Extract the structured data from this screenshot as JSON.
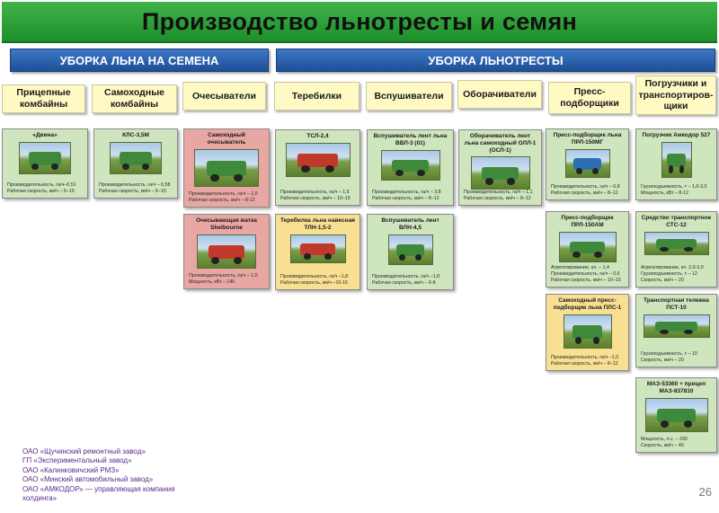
{
  "title": "Производство льнотресты и семян",
  "sections": {
    "seeds": "УБОРКА ЛЬНА НА СЕМЕНА",
    "straw": "УБОРКА ЛЬНОТРЕСТЫ"
  },
  "categories": [
    "Прицепные комбайны",
    "Самоходные комбайны",
    "Очесыватели",
    "Теребилки",
    "Вспушиватели",
    "Оборачиватели",
    "Пресс-подборщики",
    "Погрузчики и транспортиров-щики"
  ],
  "cards": {
    "dvina": {
      "title": "«Двина»",
      "lines": [
        "Производительность, га/ч–0,51",
        "Рабочая скорость, км/ч – 6–10"
      ]
    },
    "kls": {
      "title": "КЛС-3,5М",
      "lines": [
        "Производительность, га/ч – 0,58",
        "Рабочая скорость, км/ч – 6–10"
      ]
    },
    "ocheс_self": {
      "title": "Самоходный очесыватель",
      "lines": [
        "Производительность, га/ч – 1,0",
        "Рабочая скорость, км/ч – 8-12"
      ]
    },
    "shelbourne": {
      "title": "Очесывающая жатка Shelbourne",
      "lines": [
        "Производительность, га/ч – 1,0",
        "Мощность, кВт – 140"
      ]
    },
    "tsl": {
      "title": "ТСЛ-2,4",
      "lines": [
        "Производительность, га/ч – 1,5",
        "Рабочая скорость, км/ч – 10–15"
      ]
    },
    "tln": {
      "title": "Теребилка льна навесная ТЛН-1,5-2",
      "lines": [
        "Производительность, га/ч –1,8",
        "Рабочая скорость, км/ч –10-15"
      ]
    },
    "vvl3": {
      "title": "Вспушиватель лент льна ВВЛ-3 (01)",
      "lines": [
        "Производительность, га/ч – 3,8",
        "Рабочая скорость, км/ч – 8–12"
      ]
    },
    "vln": {
      "title": "Вспушиватель лент ВЛН-4,5",
      "lines": [
        "Производительность, га/ч –1,8",
        "Рабочая скорость, км/ч – 6-8"
      ]
    },
    "oll": {
      "title": "Оборачиватель лент льна самоходный ОЛЛ-1 (ОСЛ-1)",
      "lines": [
        "Производительность, га/ч – 1,1",
        "Рабочая скорость, км/ч – 8–12"
      ]
    },
    "prl150mg": {
      "title": "Пресс-подборщик льна ПРЛ-150МГ",
      "lines": [
        "Производительность, га/ч – 0,8",
        "Рабочая скорость, км/ч – 8–12"
      ]
    },
    "prl150am": {
      "title": "Пресс-подборщик ПРЛ-150АМ",
      "lines": [
        "Агрегатирование, кл. – 1,4",
        "Производительность, га/ч – 0,6",
        "Рабочая скорость, км/ч – 10–15"
      ]
    },
    "pls1": {
      "title": "Самоходный пресс-подборщик льна ПЛС-1",
      "lines": [
        "Производительность, га/ч –1,0",
        "Рабочая скорость, км/ч – 8–12"
      ]
    },
    "amkodor": {
      "title": "Погрузчик Амкодор 527",
      "lines": [
        "Грузоподъемность, т – 1,0-2,0",
        "Мощность, кВт – 8-12"
      ]
    },
    "sts12": {
      "title": "Средство транспортное СТС-12",
      "lines": [
        "Агрегатирование, кл. 2,0-3,0",
        "Грузоподъемность, т – 12",
        "Скорость, км/ч – 20"
      ]
    },
    "pst10": {
      "title": "Транспортная тележка ПСТ-10",
      "lines": [
        "Грузоподъемность, т – 10",
        "Скорость, км/ч – 20"
      ]
    },
    "maz": {
      "title": "МАЗ-53360 + прицеп МАЗ-837810",
      "lines": [
        "Мощность, л.с. – 330",
        "Скорость, км/ч – 40"
      ]
    }
  },
  "footer": [
    "ОАО «Щучинский ремонтный завод»",
    "ГП «Экспериментальный завод»",
    "ОАО «Калинковичский РМЗ»",
    "ОАО «Минский автомобильный завод»",
    "ОАО «АМКОДОР» — управляющая компания холдинга»"
  ],
  "page_number": "26",
  "colors": {
    "title_green": "#2ea13b",
    "section_blue": "#2a62b0",
    "category_yellow": "#fff9c4",
    "card_green": "#cfe5bd",
    "card_red": "#e8a7a2",
    "card_yellow": "#f8df92",
    "footer_purple": "#5b2a8c"
  }
}
